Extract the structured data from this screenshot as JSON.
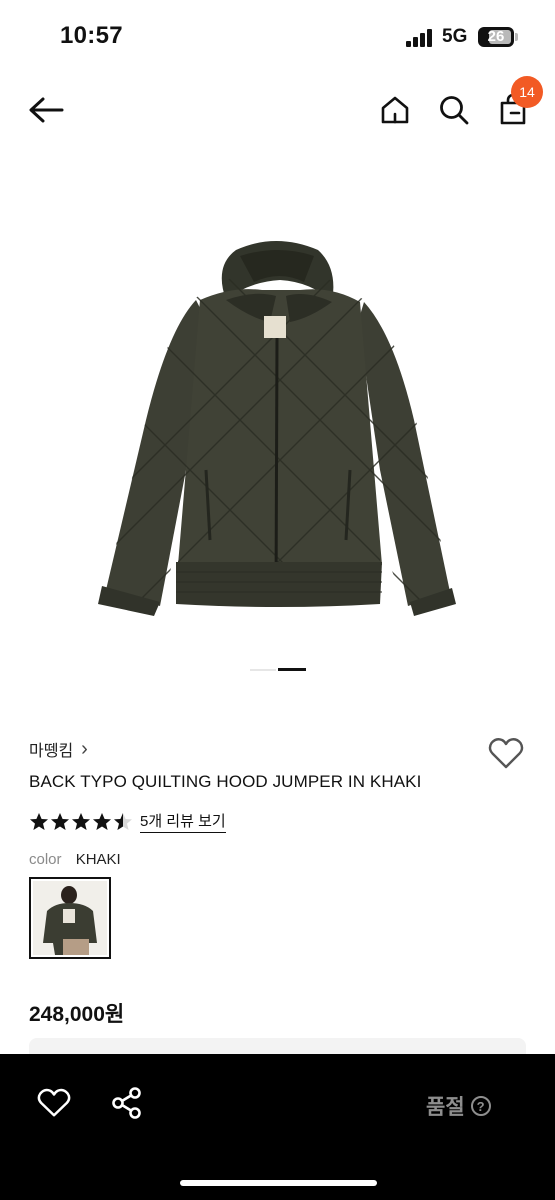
{
  "status_bar": {
    "time": "10:57",
    "network": "5G",
    "battery": "26",
    "icons": [
      "signal-icon",
      "battery-icon"
    ]
  },
  "nav": {
    "icons": [
      "back-arrow-icon",
      "home-icon",
      "search-icon",
      "shopping-bag-icon"
    ],
    "cart_count": "14",
    "badge_color": "#f25a24"
  },
  "product": {
    "brand": "마뗑킴",
    "brand_chevron": "›",
    "name": "BACK TYPO QUILTING HOOD JUMPER IN KHAKI",
    "rating": 4.5,
    "review_link": "5개 리뷰 보기",
    "color_label": "color",
    "color_value": "KHAKI",
    "price": "248,000원",
    "image_count": 2,
    "active_image": 2
  },
  "bottom_bar": {
    "icons": [
      "heart-icon",
      "share-icon"
    ],
    "status": "품절",
    "help_glyph": "?"
  },
  "colors": {
    "accent": "#f25a24",
    "jacket": "#3e3f34",
    "bottom_bar": "#000000",
    "disabled_text": "#8e8e8e"
  }
}
